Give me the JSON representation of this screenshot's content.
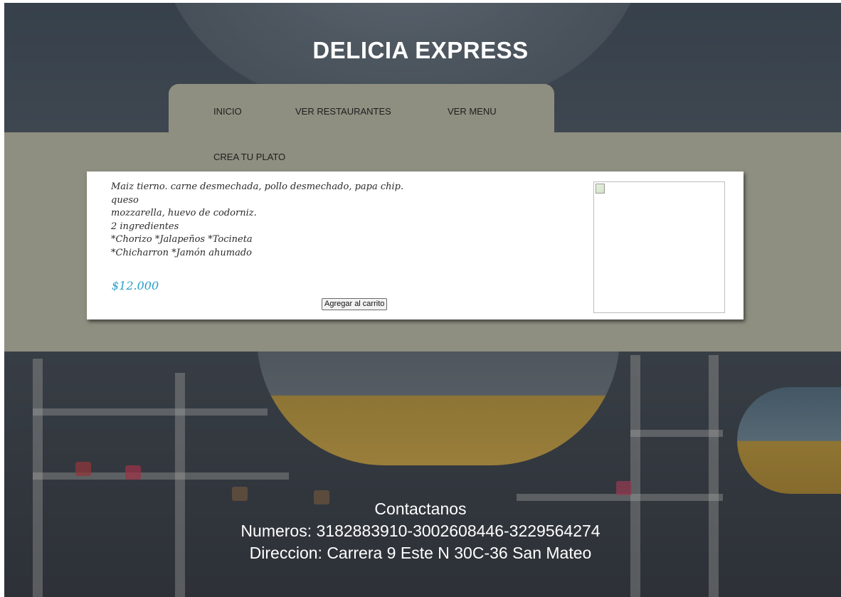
{
  "header": {
    "title": "DELICIA EXPRESS"
  },
  "nav": {
    "items": [
      "INICIO",
      "VER RESTAURANTES",
      "VER MENU"
    ],
    "secondary": "CREA TU PLATO"
  },
  "product": {
    "description_lines": [
      "Maiz tierno. carne desmechada, pollo desmechado, papa chip.",
      "queso",
      "mozzarella, huevo de codorniz.",
      "2 ingredientes",
      "*Chorizo *Jalapeños *Tocineta",
      "*Chicharron *Jamón ahumado"
    ],
    "price": "$12.000",
    "add_to_cart_label": "Agregar al carrito",
    "image_icon": "broken-image-icon"
  },
  "footer": {
    "heading": "Contactanos",
    "phones": "Numeros: 3182883910-3002608446-3229564274",
    "address": "Direccion: Carrera 9 Este N 30C-36 San Mateo"
  },
  "colors": {
    "band": "#8e8f80",
    "price": "#2a9fc9",
    "title": "#ffffff"
  }
}
